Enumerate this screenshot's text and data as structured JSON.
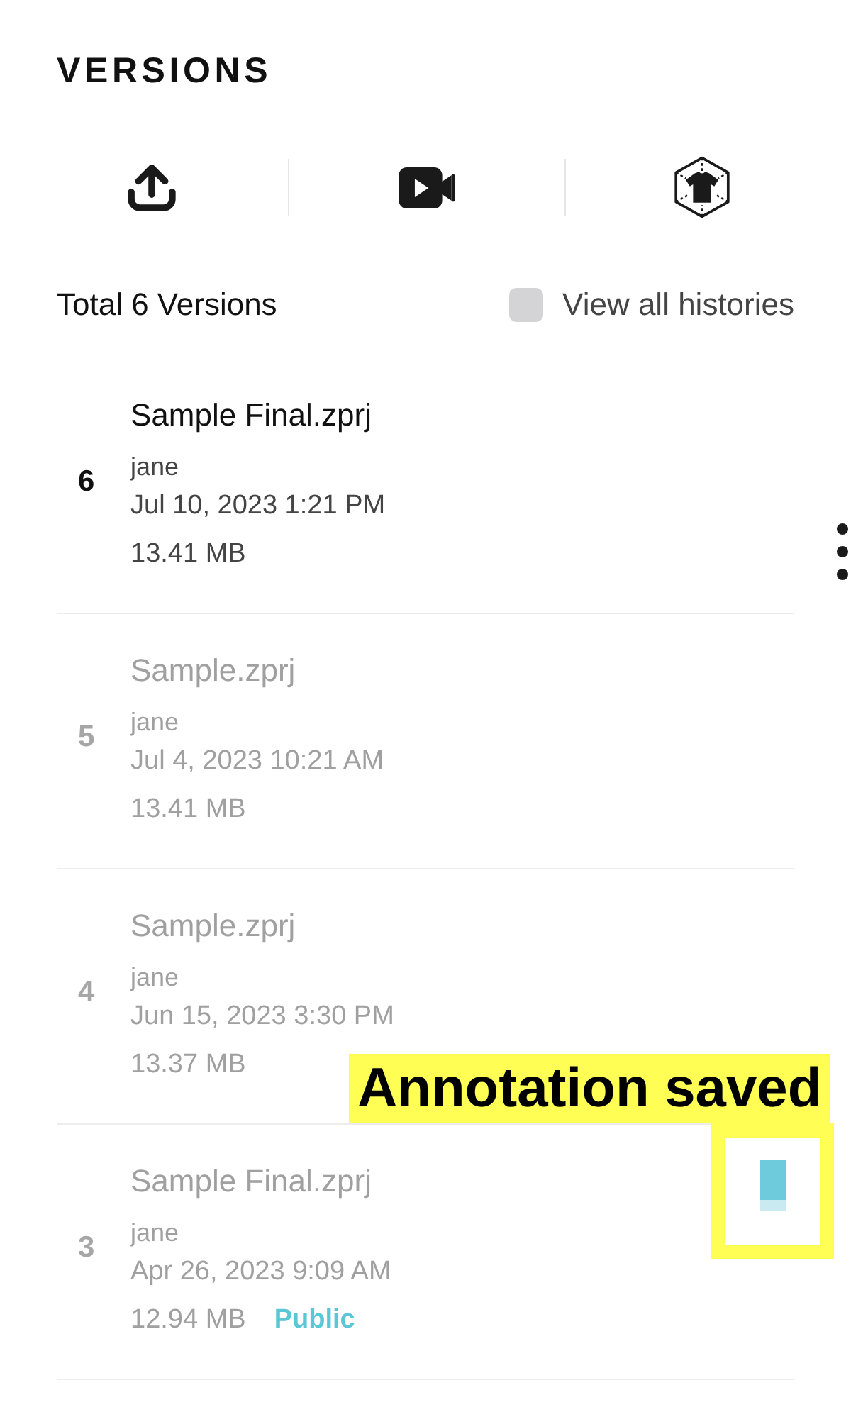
{
  "title": "VERSIONS",
  "summary": {
    "total": "Total 6 Versions",
    "view_all": {
      "label": "View all histories",
      "checked": false
    }
  },
  "versions": [
    {
      "number": "6",
      "name": "Sample Final.zprj",
      "author": "jane",
      "date": "Jul 10, 2023 1:21 PM",
      "size": "13.41 MB",
      "selected": true
    },
    {
      "number": "5",
      "name": "Sample.zprj",
      "author": "jane",
      "date": "Jul 4, 2023 10:21 AM",
      "size": "13.41 MB",
      "selected": false
    },
    {
      "number": "4",
      "name": "Sample.zprj",
      "author": "jane",
      "date": "Jun 15, 2023 3:30 PM",
      "size": "13.37 MB",
      "selected": false
    },
    {
      "number": "3",
      "name": "Sample Final.zprj",
      "author": "jane",
      "date": "Apr 26, 2023 9:09 AM",
      "size": "12.94 MB",
      "tag": "Public",
      "selected": false,
      "annotation": {
        "label": "Annotation saved"
      }
    }
  ]
}
